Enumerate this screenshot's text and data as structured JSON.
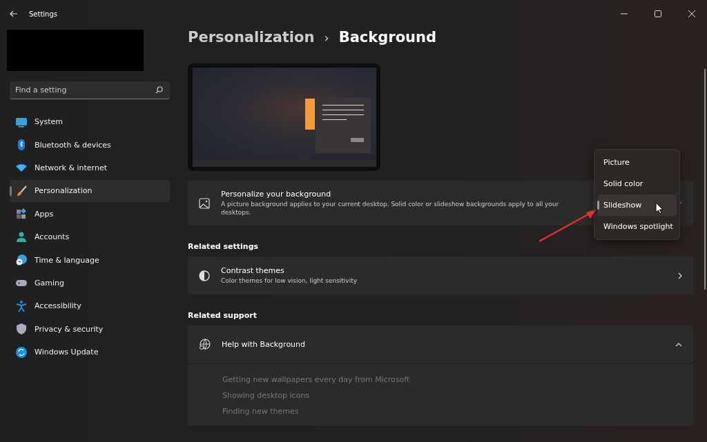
{
  "window": {
    "title": "Settings"
  },
  "search": {
    "placeholder": "Find a setting"
  },
  "sidebar": {
    "items": [
      {
        "label": "System",
        "kind": "system",
        "selected": false
      },
      {
        "label": "Bluetooth & devices",
        "kind": "bluetooth",
        "selected": false
      },
      {
        "label": "Network & internet",
        "kind": "network",
        "selected": false
      },
      {
        "label": "Personalization",
        "kind": "brush",
        "selected": true
      },
      {
        "label": "Apps",
        "kind": "apps",
        "selected": false
      },
      {
        "label": "Accounts",
        "kind": "accounts",
        "selected": false
      },
      {
        "label": "Time & language",
        "kind": "time",
        "selected": false
      },
      {
        "label": "Gaming",
        "kind": "gaming",
        "selected": false
      },
      {
        "label": "Accessibility",
        "kind": "accessibility",
        "selected": false
      },
      {
        "label": "Privacy & security",
        "kind": "privacy",
        "selected": false
      },
      {
        "label": "Windows Update",
        "kind": "update",
        "selected": false
      }
    ]
  },
  "breadcrumb": {
    "parent": "Personalization",
    "separator": "›",
    "current": "Background"
  },
  "background_card": {
    "title": "Personalize your background",
    "description": "A picture background applies to your current desktop. Solid color or slideshow backgrounds apply to all your desktops."
  },
  "dropdown_menu": {
    "options": [
      {
        "label": "Picture",
        "selected": false
      },
      {
        "label": "Solid color",
        "selected": false
      },
      {
        "label": "Slideshow",
        "selected": true
      },
      {
        "label": "Windows spotlight",
        "selected": false
      }
    ]
  },
  "related_settings": {
    "heading": "Related settings",
    "items": [
      {
        "title": "Contrast themes",
        "description": "Color themes for low vision, light sensitivity"
      }
    ]
  },
  "related_support": {
    "heading": "Related support",
    "title": "Help with Background",
    "expanded": true,
    "links": [
      "Getting new wallpapers every day from Microsoft",
      "Showing desktop icons",
      "Finding new themes"
    ]
  }
}
